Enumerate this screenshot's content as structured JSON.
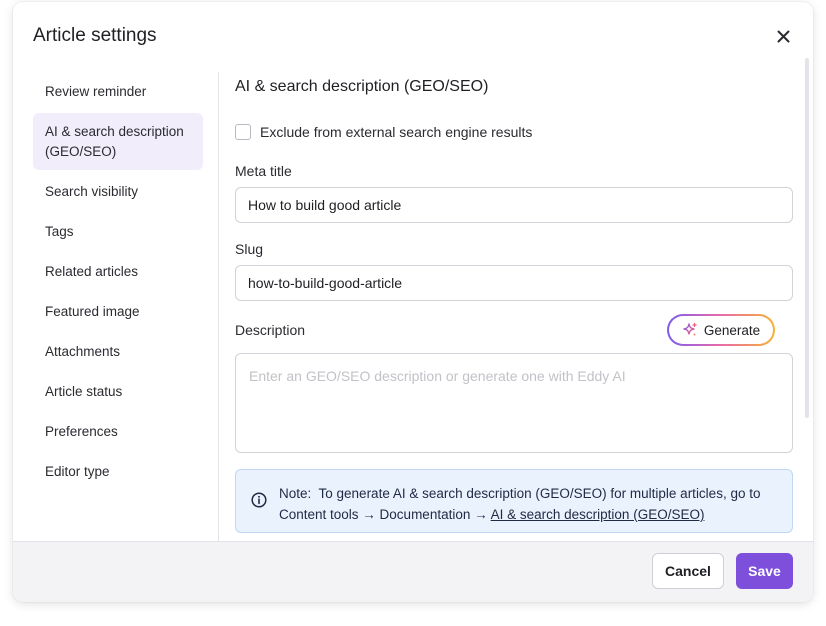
{
  "modal": {
    "title": "Article settings",
    "close_icon": "close-icon"
  },
  "sidebar": {
    "items": [
      {
        "label": "Review reminder",
        "active": false
      },
      {
        "label": "AI & search description (GEO/SEO)",
        "active": true
      },
      {
        "label": "Search visibility",
        "active": false
      },
      {
        "label": "Tags",
        "active": false
      },
      {
        "label": "Related articles",
        "active": false
      },
      {
        "label": "Featured image",
        "active": false
      },
      {
        "label": "Attachments",
        "active": false
      },
      {
        "label": "Article status",
        "active": false
      },
      {
        "label": "Preferences",
        "active": false
      },
      {
        "label": "Editor type",
        "active": false
      }
    ]
  },
  "content": {
    "section_title": "AI & search description (GEO/SEO)",
    "exclude_checkbox": {
      "label": "Exclude from external search engine results",
      "checked": false
    },
    "meta_title": {
      "label": "Meta title",
      "value": "How to build good article"
    },
    "slug": {
      "label": "Slug",
      "value": "how-to-build-good-article"
    },
    "description": {
      "label": "Description",
      "placeholder": "Enter an GEO/SEO description or generate one with Eddy AI",
      "value": ""
    },
    "generate_button": {
      "label": "Generate",
      "icon": "sparkle-icon"
    },
    "note": {
      "icon": "info-icon",
      "text": "Note:  To generate AI & search description (GEO/SEO) for multiple articles, go to Content tools → Documentation → ",
      "link_text": "AI & search description (GEO/SEO)"
    }
  },
  "footer": {
    "cancel_label": "Cancel",
    "save_label": "Save"
  },
  "colors": {
    "accent": "#7d4fdb",
    "active_bg": "#f1edfb",
    "note_bg": "#eaf2fd",
    "note_border": "#bfd6f5"
  }
}
